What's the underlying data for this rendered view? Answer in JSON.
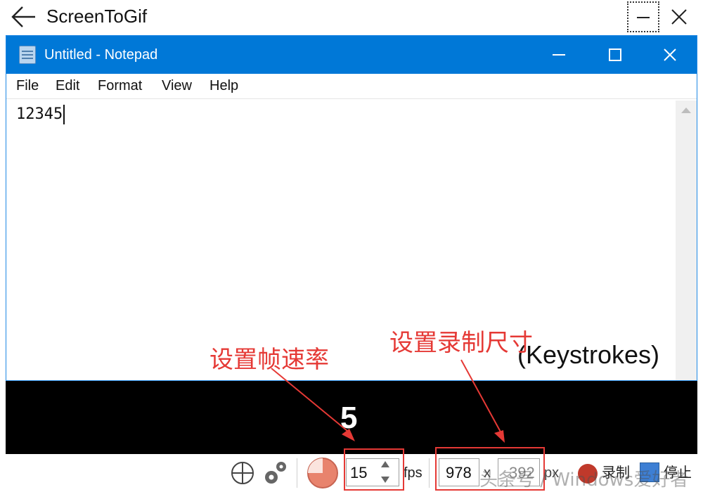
{
  "app": {
    "title": "ScreenToGif"
  },
  "notepad": {
    "title": "Untitled - Notepad",
    "menu": [
      "File",
      "Edit",
      "Format",
      "View",
      "Help"
    ],
    "content": "12345"
  },
  "overlay": {
    "keystrokes": "(Keystrokes)",
    "big_number": "5"
  },
  "toolbar": {
    "fps_value": "15",
    "fps_label": "fps",
    "width_value": "978",
    "x_label": "x",
    "height_value": "392",
    "px_label": "px",
    "record_label": "录制",
    "stop_label": "停止"
  },
  "annotations": {
    "framerate": "设置帧速率",
    "size": "设置录制尺寸"
  },
  "watermark": "头条号 / Windows爱好者",
  "colors": {
    "notepad_titlebar": "#0078d7",
    "annotation": "#e53935",
    "record": "#c0392b",
    "stop": "#3d7fd4"
  }
}
